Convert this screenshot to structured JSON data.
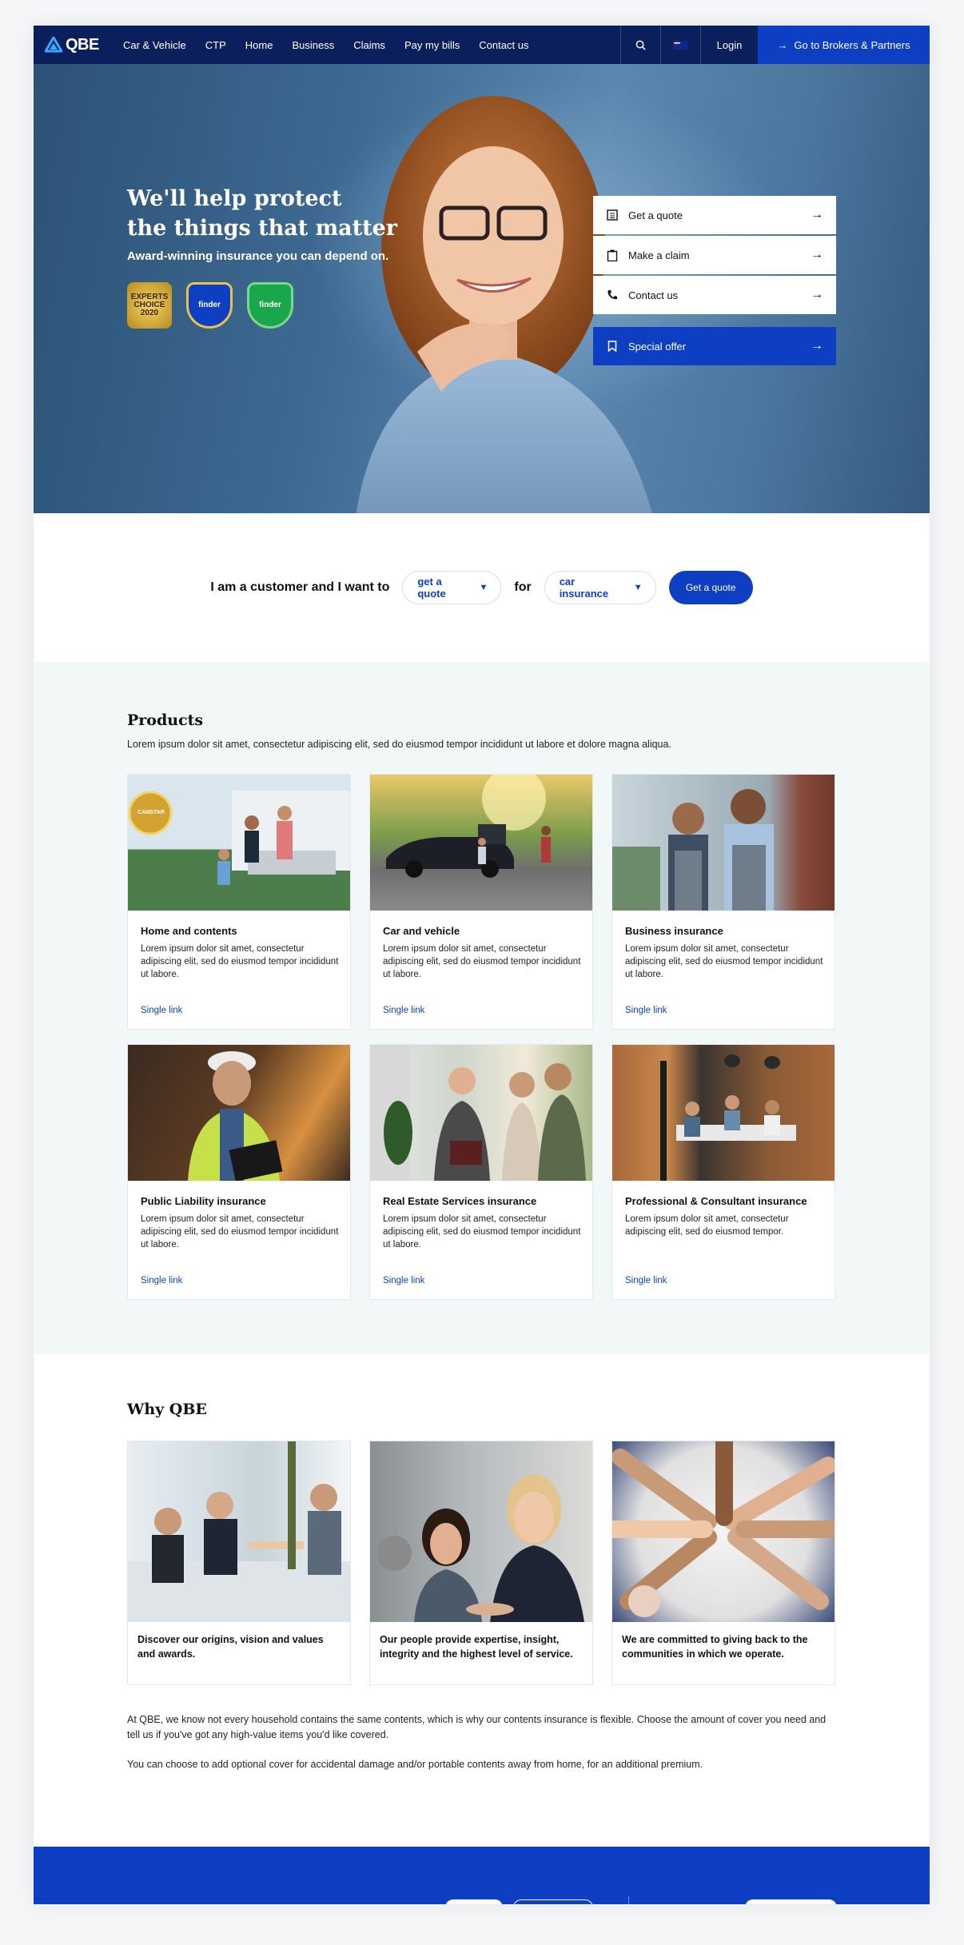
{
  "brand": {
    "name": "QBE",
    "primary": "#0e3fc2",
    "nav_bg": "#0a1f5c"
  },
  "nav": {
    "links": [
      "Car & Vehicle",
      "CTP",
      "Home",
      "Business",
      "Claims",
      "Pay my bills",
      "Contact us"
    ],
    "login": "Login",
    "brokers": "Go to Brokers & Partners"
  },
  "hero": {
    "title_line1": "We'll help protect",
    "title_line2": "the things that matter",
    "subtitle": "Award-winning insurance you can depend on.",
    "awards": [
      {
        "label": "EXPERTS CHOICE 2020",
        "icon": "award-badge-icon"
      },
      {
        "label": "finder",
        "icon": "finder-award-icon"
      },
      {
        "label": "finder",
        "icon": "finder-award-icon"
      }
    ],
    "menu": [
      {
        "label": "Get a quote",
        "icon": "calculator-icon"
      },
      {
        "label": "Make a claim",
        "icon": "clipboard-icon"
      },
      {
        "label": "Contact us",
        "icon": "phone-icon"
      }
    ],
    "special": "Special offer"
  },
  "selector": {
    "prefix": "I am a customer and I want to",
    "action": "get a quote",
    "connector": "for",
    "product": "car insurance",
    "button": "Get a quote"
  },
  "products": {
    "title": "Products",
    "description": "Lorem ipsum dolor sit amet, consectetur adipiscing elit, sed do eiusmod tempor incididunt ut labore et dolore magna aliqua.",
    "cards": [
      {
        "title": "Home and contents",
        "text": "Lorem ipsum dolor sit amet, consectetur adipiscing elit, sed do eiusmod tempor incididunt ut labore.",
        "link": "Single link",
        "badge": "CANSTAR"
      },
      {
        "title": "Car and vehicle",
        "text": "Lorem ipsum dolor sit amet, consectetur adipiscing elit, sed do eiusmod tempor incididunt ut labore.",
        "link": "Single link"
      },
      {
        "title": "Business insurance",
        "text": "Lorem ipsum dolor sit amet, consectetur adipiscing elit, sed do eiusmod tempor incididunt ut labore.",
        "link": "Single link"
      },
      {
        "title": "Public Liability insurance",
        "text": "Lorem ipsum dolor sit amet, consectetur adipiscing elit, sed do eiusmod tempor incididunt ut labore.",
        "link": "Single link"
      },
      {
        "title": "Real Estate Services insurance",
        "text": "Lorem ipsum dolor sit amet, consectetur adipiscing elit, sed do eiusmod tempor incididunt ut labore.",
        "link": "Single link"
      },
      {
        "title": "Professional & Consultant insurance",
        "text": "Lorem ipsum dolor sit amet, consectetur adipiscing elit, sed do eiusmod tempor.",
        "link": "Single link"
      }
    ]
  },
  "why": {
    "title": "Why QBE",
    "cards": [
      "Discover our origins, vision and values and awards.",
      "Our people provide expertise, insight, integrity and the highest level of service.",
      "We are committed to giving back to the communities in which we operate."
    ],
    "paragraph1": "At QBE, we know not every household contains the same contents, which is why our contents insurance is flexible. Choose the amount of cover you need and tell us if you've got any high-value items you'd like covered.",
    "paragraph2": "You can choose to add optional cover for accidental damage and/or portable contents away from home, for an additional premium."
  }
}
